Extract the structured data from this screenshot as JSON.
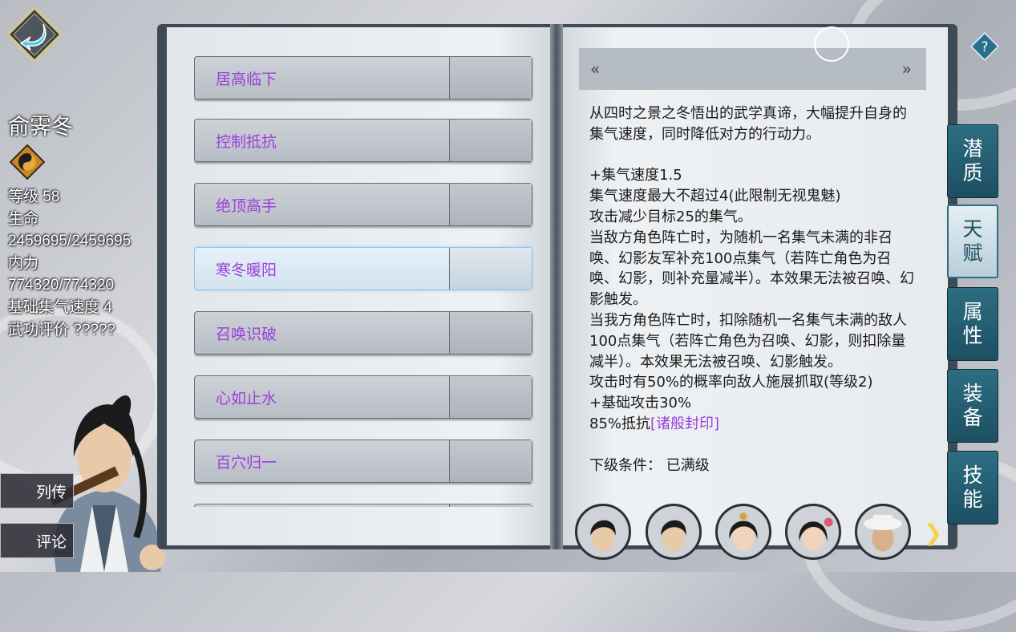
{
  "character": {
    "name": "俞霁冬",
    "stats": [
      "等级 58",
      "生命",
      "2459695/2459695",
      "内力",
      "774320/774320",
      "基础集气速度 4",
      "武功评价 ?????"
    ]
  },
  "side_buttons": {
    "biography": "列传",
    "comment": "评论"
  },
  "talents": [
    "居高临下",
    "控制抵抗",
    "绝顶高手",
    "寒冬暖阳",
    "召唤识破",
    "心如止水",
    "百穴归一",
    ""
  ],
  "selected_talent_index": 3,
  "nav": {
    "prev": "«",
    "next": "»"
  },
  "description": [
    {
      "text": "从四时之景之冬悟出的武学真谛，大幅提升自身的集气速度，同时降低对方的行动力。"
    },
    {
      "text": ""
    },
    {
      "text": "+集气速度1.5"
    },
    {
      "text": "集气速度最大不超过4(此限制无视鬼魅)"
    },
    {
      "text": "攻击减少目标25的集气。"
    },
    {
      "text": "当敌方角色阵亡时，为随机一名集气未满的非召唤、幻影友军补充100点集气（若阵亡角色为召唤、幻影，则补充量减半）。本效果无法被召唤、幻影触发。"
    },
    {
      "text": "当我方角色阵亡时，扣除随机一名集气未满的敌人100点集气（若阵亡角色为召唤、幻影，则扣除量减半）。本效果无法被召唤、幻影触发。"
    },
    {
      "text": "攻击时有50%的概率向敌人施展抓取(等级2)"
    },
    {
      "text": "+基础攻击30%"
    },
    {
      "text": "85%抵抗",
      "tag": "[诸般封印]"
    },
    {
      "text": ""
    },
    {
      "text": "下级条件：  已满级"
    }
  ],
  "tabs": [
    "潜质",
    "天赋",
    "属性",
    "装备",
    "技能"
  ],
  "active_tab_index": 1,
  "colors": {
    "purple": "#9a3fd9",
    "tab": "#2d6e82"
  }
}
